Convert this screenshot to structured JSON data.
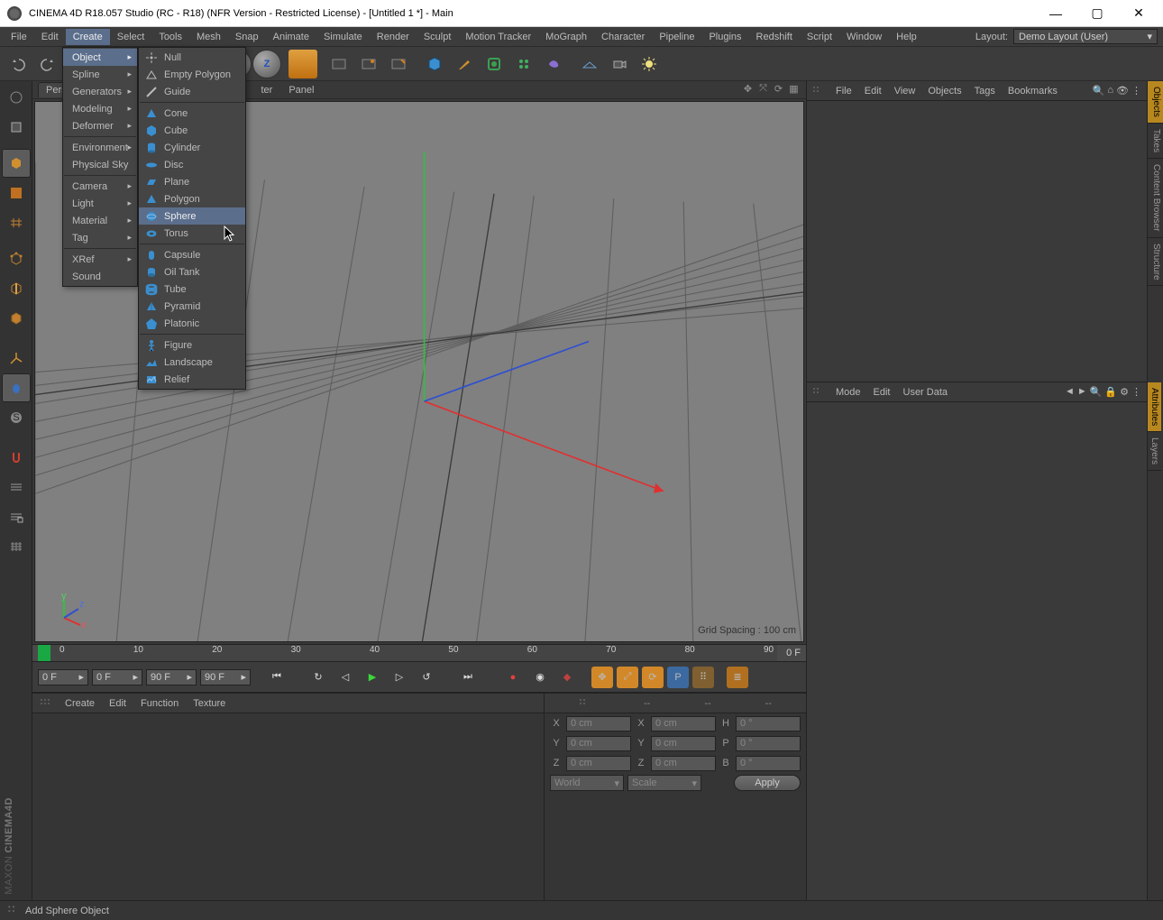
{
  "title": "CINEMA 4D R18.057 Studio (RC - R18) (NFR Version - Restricted License) - [Untitled 1 *] - Main",
  "menubar": [
    "File",
    "Edit",
    "Create",
    "Select",
    "Tools",
    "Mesh",
    "Snap",
    "Animate",
    "Simulate",
    "Render",
    "Sculpt",
    "Motion Tracker",
    "MoGraph",
    "Character",
    "Pipeline",
    "Plugins",
    "Redshift",
    "Script",
    "Window",
    "Help"
  ],
  "menubar_active": "Create",
  "layout": {
    "label": "Layout:",
    "value": "Demo Layout (User)"
  },
  "create_menu": {
    "items": [
      {
        "label": "Object",
        "sub": true,
        "active": true
      },
      {
        "label": "Spline",
        "sub": true
      },
      {
        "label": "Generators",
        "sub": true
      },
      {
        "label": "Modeling",
        "sub": true
      },
      {
        "label": "Deformer",
        "sub": true
      },
      {
        "sep": true
      },
      {
        "label": "Environment",
        "sub": true
      },
      {
        "label": "Physical Sky"
      },
      {
        "sep": true
      },
      {
        "label": "Camera",
        "sub": true
      },
      {
        "label": "Light",
        "sub": true
      },
      {
        "label": "Material",
        "sub": true
      },
      {
        "label": "Tag",
        "sub": true
      },
      {
        "sep": true
      },
      {
        "label": "XRef",
        "sub": true
      },
      {
        "label": "Sound"
      }
    ]
  },
  "object_submenu": [
    {
      "label": "Null",
      "icon": "null"
    },
    {
      "label": "Empty Polygon",
      "icon": "poly"
    },
    {
      "label": "Guide",
      "icon": "guide"
    },
    {
      "sep": true
    },
    {
      "label": "Cone",
      "icon": "cone"
    },
    {
      "label": "Cube",
      "icon": "cube"
    },
    {
      "label": "Cylinder",
      "icon": "cyl"
    },
    {
      "label": "Disc",
      "icon": "disc"
    },
    {
      "label": "Plane",
      "icon": "plane"
    },
    {
      "label": "Polygon",
      "icon": "polygon"
    },
    {
      "label": "Sphere",
      "icon": "sphere",
      "hover": true
    },
    {
      "label": "Torus",
      "icon": "torus"
    },
    {
      "sep": true
    },
    {
      "label": "Capsule",
      "icon": "capsule"
    },
    {
      "label": "Oil Tank",
      "icon": "oiltank"
    },
    {
      "label": "Tube",
      "icon": "tube"
    },
    {
      "label": "Pyramid",
      "icon": "pyramid"
    },
    {
      "label": "Platonic",
      "icon": "platonic"
    },
    {
      "sep": true
    },
    {
      "label": "Figure",
      "icon": "figure"
    },
    {
      "label": "Landscape",
      "icon": "landscape"
    },
    {
      "label": "Relief",
      "icon": "relief"
    }
  ],
  "viewport": {
    "tab": "Perspective",
    "menu_visible": [
      "ter",
      "Panel"
    ],
    "grid_spacing": "Grid Spacing : 100 cm",
    "gizmo": {
      "x": "x",
      "y": "y",
      "z": "z"
    }
  },
  "timeline": {
    "start": "0",
    "ticks": [
      "10",
      "20",
      "30",
      "40",
      "50",
      "60",
      "70",
      "80",
      "90"
    ],
    "end": "0 F",
    "spinA": "0 F",
    "spinB": "0 F",
    "spinC": "90 F",
    "spinD": "90 F"
  },
  "obj_panel": {
    "menu": [
      "File",
      "Edit",
      "View",
      "Objects",
      "Tags",
      "Bookmarks"
    ]
  },
  "attr_panel": {
    "menu": [
      "Mode",
      "Edit",
      "User Data"
    ]
  },
  "mat_panel": {
    "menu": [
      "Create",
      "Edit",
      "Function",
      "Texture"
    ]
  },
  "coord": {
    "hdr": [
      "--",
      "--",
      "--"
    ],
    "rows": [
      {
        "a": "X",
        "av": "0 cm",
        "b": "X",
        "bv": "0 cm",
        "c": "H",
        "cv": "0 °"
      },
      {
        "a": "Y",
        "av": "0 cm",
        "b": "Y",
        "bv": "0 cm",
        "c": "P",
        "cv": "0 °"
      },
      {
        "a": "Z",
        "av": "0 cm",
        "b": "Z",
        "bv": "0 cm",
        "c": "B",
        "cv": "0 °"
      }
    ],
    "world": "World",
    "scale": "Scale",
    "apply": "Apply"
  },
  "sidetabs": [
    "Objects",
    "Takes",
    "Content Browser",
    "Structure"
  ],
  "sidetabs2": [
    "Attributes",
    "Layers"
  ],
  "status": "Add Sphere Object",
  "brand1": "MAXON",
  "brand2": "CINEMA4D"
}
